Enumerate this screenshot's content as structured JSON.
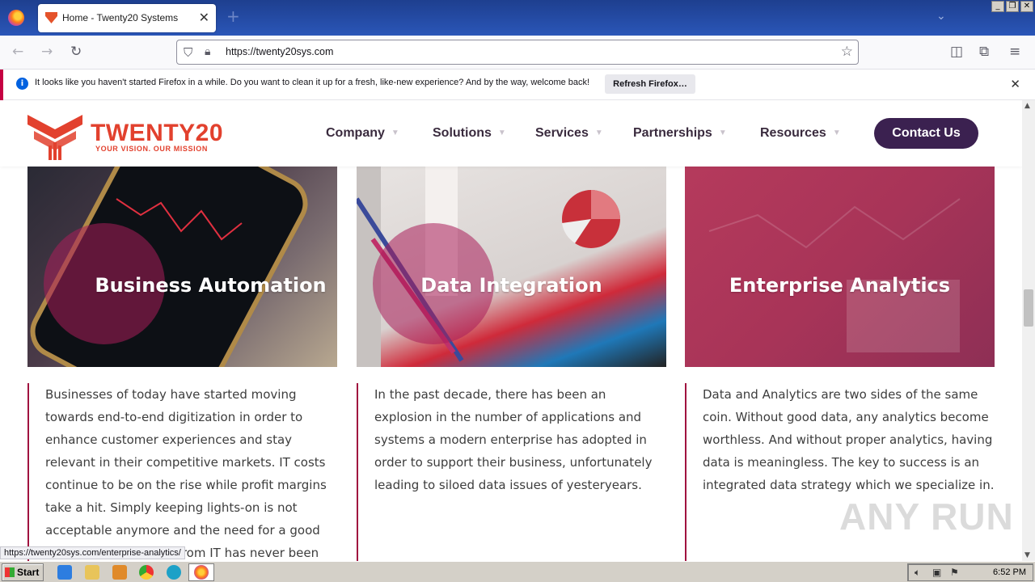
{
  "browser": {
    "tab_title": "Home - Twenty20 Systems",
    "url": "https://twenty20sys.com",
    "notification": "It looks like you haven't started Firefox in a while. Do you want to clean it up for a fresh, like-new experience? And by the way, welcome back!",
    "refresh_button": "Refresh Firefox…",
    "status_url": "https://twenty20sys.com/enterprise-analytics/"
  },
  "site": {
    "logo_name": "TWENTY20",
    "logo_tagline": "YOUR VISION. OUR MISSION",
    "menu": [
      "Company",
      "Solutions",
      "Services",
      "Partnerships",
      "Resources"
    ],
    "contact_button": "Contact Us",
    "brand_colors": {
      "primary": "#e2412e",
      "dark": "#3b2150",
      "accent": "#a0123f"
    }
  },
  "cards": [
    {
      "title": "Business Automation",
      "text": "Businesses of today have started moving towards end-to-end digitization in order to enhance customer experiences and stay relevant in their competitive markets. IT costs continue to be on the rise while profit margins take a hit. Simply keeping lights-on is not acceptable anymore and the need for a good return on investment from IT has never been"
    },
    {
      "title": "Data Integration",
      "text": "In the past decade, there has been an explosion in the number of applications and systems a modern enterprise has adopted in order to support their business, unfortunately leading to siloed data issues of yesteryears."
    },
    {
      "title": "Enterprise Analytics",
      "text": "Data and Analytics are two sides of the same coin. Without good data, any analytics become worthless. And without proper analytics, having data is meaningless. The key to success is an integrated data strategy which we specialize in."
    }
  ],
  "watermark": "ANY RUN",
  "taskbar": {
    "start_label": "Start",
    "clock": "6:52 PM"
  }
}
